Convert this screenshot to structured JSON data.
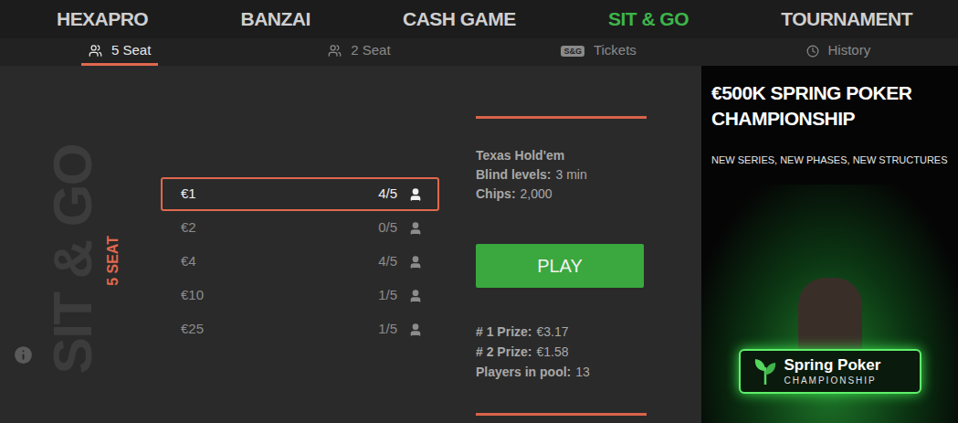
{
  "nav": [
    {
      "label": "HEXAPRO",
      "selected": false
    },
    {
      "label": "BANZAI",
      "selected": false
    },
    {
      "label": "CASH GAME",
      "selected": false
    },
    {
      "label": "SIT & GO",
      "selected": true
    },
    {
      "label": "TOURNAMENT",
      "selected": false
    }
  ],
  "subtabs": [
    {
      "label": "5 Seat",
      "selected": true,
      "kind": "seats"
    },
    {
      "label": "2 Seat",
      "selected": false,
      "kind": "seats"
    },
    {
      "label": "Tickets",
      "selected": false,
      "kind": "ticket",
      "badge": "S&G"
    },
    {
      "label": "History",
      "selected": false,
      "kind": "history"
    }
  ],
  "side": {
    "title": "SIT & GO",
    "subtitle": "5 SEAT"
  },
  "buyins": [
    {
      "price": "€1",
      "players": "4/5",
      "selected": true
    },
    {
      "price": "€2",
      "players": "0/5",
      "selected": false
    },
    {
      "price": "€4",
      "players": "4/5",
      "selected": false
    },
    {
      "price": "€10",
      "players": "1/5",
      "selected": false
    },
    {
      "price": "€25",
      "players": "1/5",
      "selected": false
    }
  ],
  "details": {
    "game": "Texas Hold'em",
    "rows": [
      {
        "label": "Blind levels:",
        "value": "3 min"
      },
      {
        "label": "Chips:",
        "value": "2,000"
      }
    ]
  },
  "play_button": "PLAY",
  "prizes": [
    {
      "label": "# 1 Prize:",
      "value": "€3.17"
    },
    {
      "label": "# 2 Prize:",
      "value": "€1.58"
    },
    {
      "label": "Players in pool:",
      "value": "13"
    }
  ],
  "banner": {
    "title": "€500K SPRING POKER CHAMPIONSHIP",
    "subtitle": "NEW SERIES, NEW PHASES, NEW STRUCTURES",
    "badge_title": "Spring Poker",
    "badge_subtitle": "CHAMPIONSHIP"
  }
}
